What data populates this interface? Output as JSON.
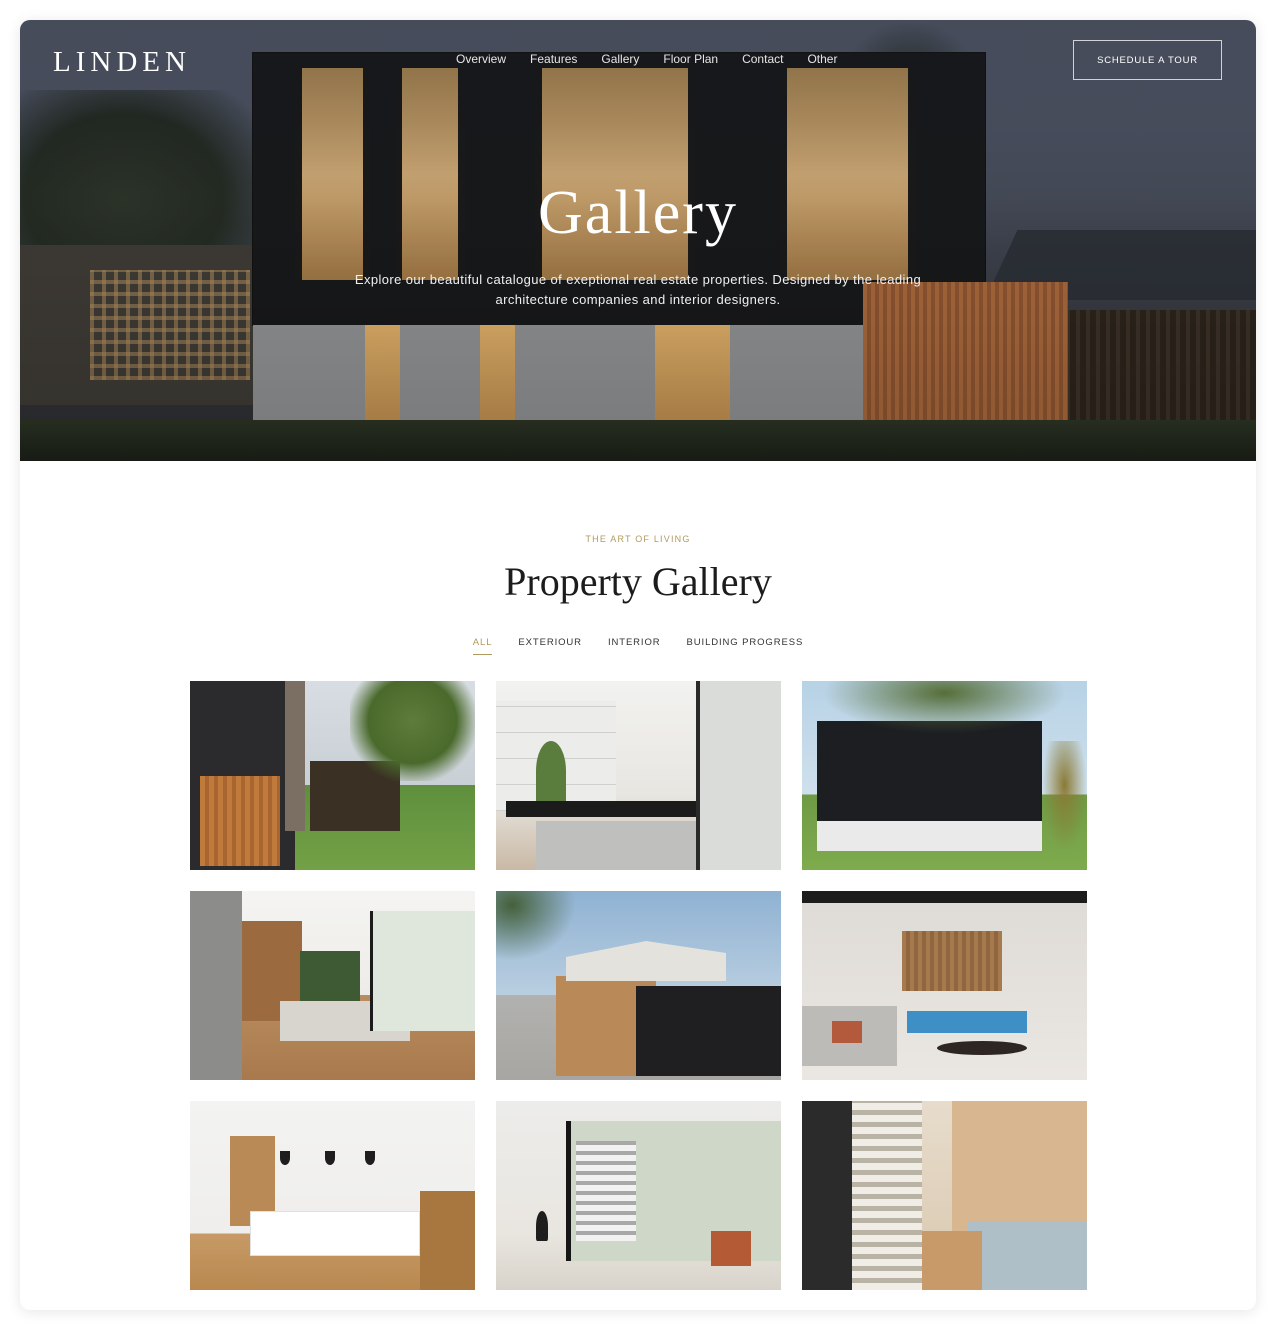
{
  "brand": {
    "logo": "LINDEN"
  },
  "nav": {
    "items": [
      "Overview",
      "Features",
      "Gallery",
      "Floor Plan",
      "Contact",
      "Other"
    ],
    "cta": "SCHEDULE A TOUR"
  },
  "hero": {
    "title": "Gallery",
    "subtitle": "Explore our beautiful catalogue of exeptional real estate properties. Designed by the leading architecture companies and interior designers."
  },
  "gallery": {
    "eyebrow": "THE ART OF LIVING",
    "title": "Property Gallery",
    "filters": [
      {
        "label": "ALL",
        "active": true
      },
      {
        "label": "EXTERIOUR",
        "active": false
      },
      {
        "label": "INTERIOR",
        "active": false
      },
      {
        "label": "BUILDING PROGRESS",
        "active": false
      }
    ],
    "accent_color": "#b29a5e"
  }
}
